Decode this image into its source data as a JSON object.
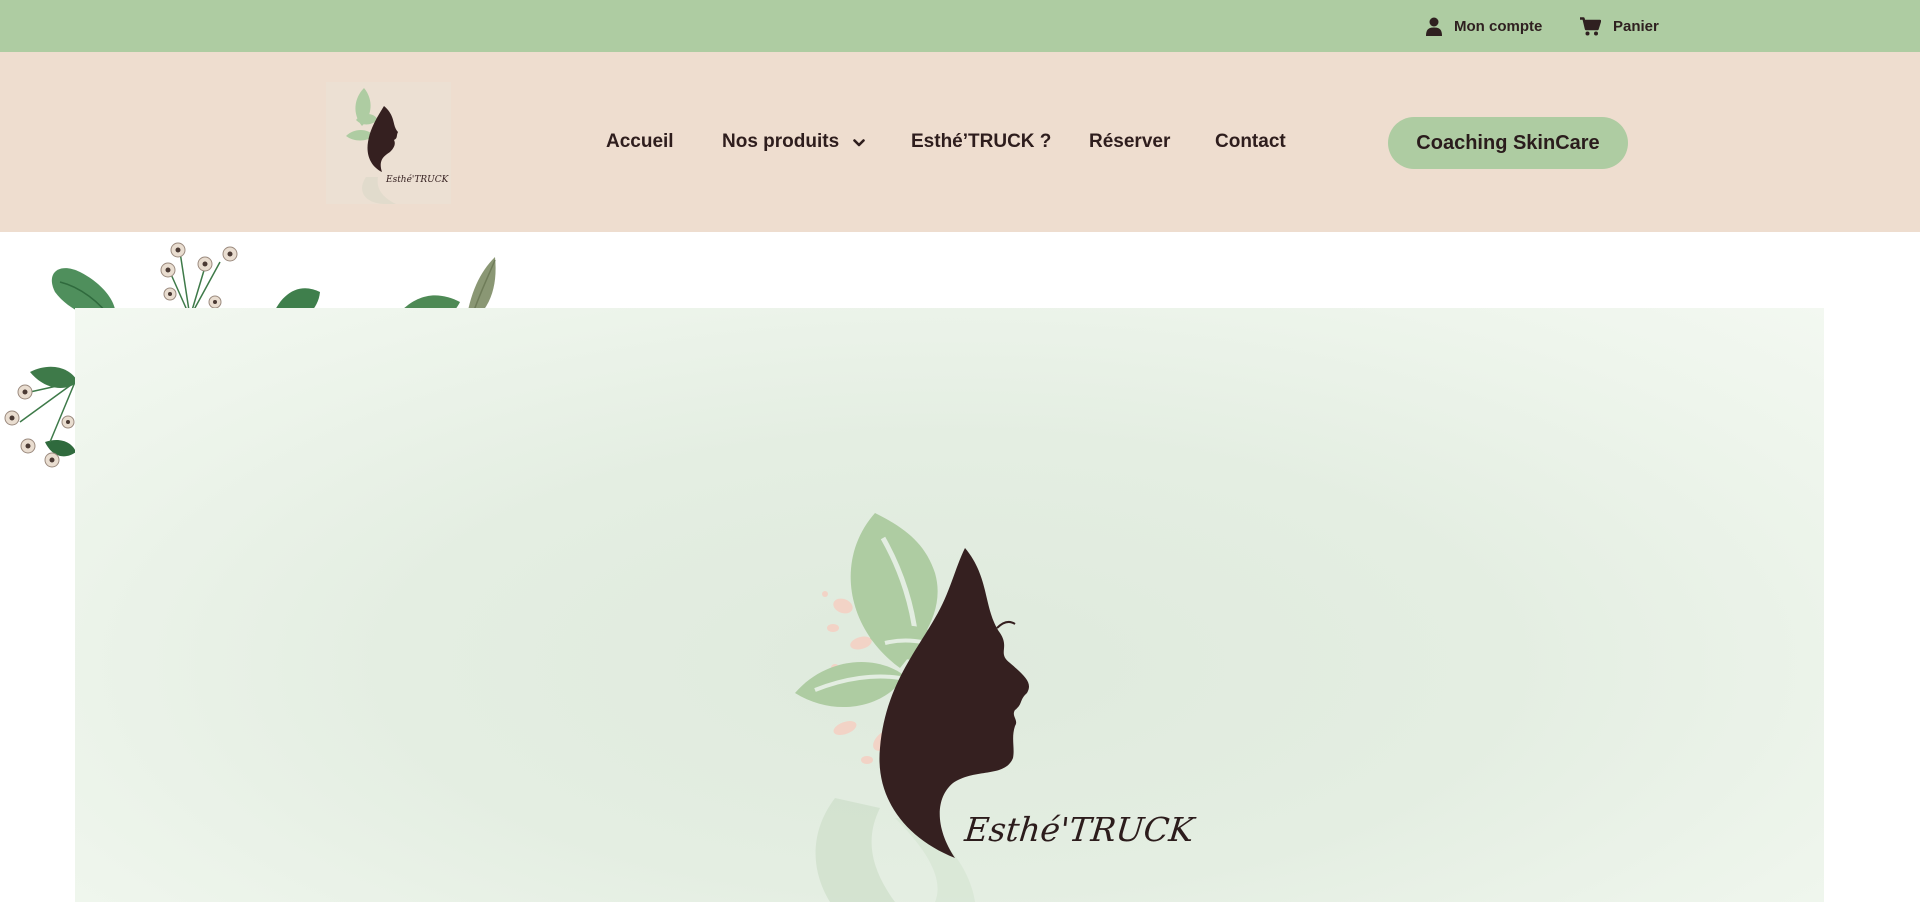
{
  "topbar": {
    "account_label": "Mon compte",
    "account_icon": "user-icon",
    "cart_label": "Panier",
    "cart_icon": "cart-icon",
    "background": "#aecca2"
  },
  "header": {
    "background": "#eeddcf",
    "logo_text": "Esthé'TRUCK",
    "nav": {
      "home": "Accueil",
      "products": "Nos produits",
      "products_icon": "chevron-down-icon",
      "esthe": "Esthé’TRUCK ?",
      "reserve": "Réserver",
      "contact": "Contact"
    },
    "cta_label": "Coaching SkinCare",
    "cta_color": "#aecca2"
  },
  "hero": {
    "logo_text": "Esthé'TRUCK",
    "background": "#e3ede1"
  },
  "colors": {
    "brand_green": "#aecca2",
    "brand_dark": "#2e1d1d",
    "brand_peach": "#eeddcf"
  }
}
